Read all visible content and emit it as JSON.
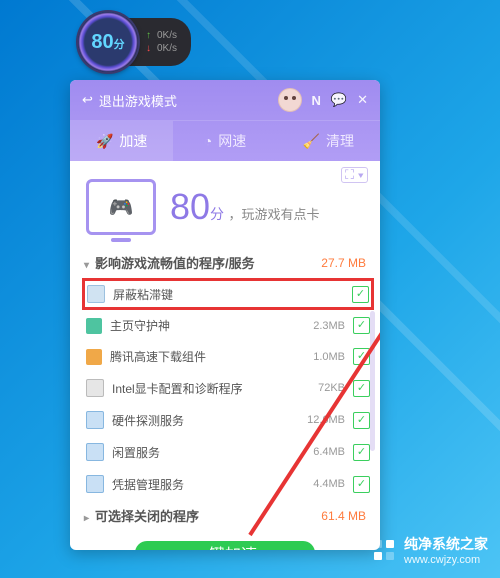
{
  "widget": {
    "score": "80",
    "unit": "分",
    "up": "0K/s",
    "down": "0K/s"
  },
  "header": {
    "back_label": "退出游戏模式",
    "tabs": [
      {
        "label": "加速",
        "icon": "rocket",
        "active": true
      },
      {
        "label": "网速",
        "icon": "gauge"
      },
      {
        "label": "清理",
        "icon": "broom"
      }
    ]
  },
  "score": {
    "value": "80",
    "unit": "分",
    "comment": "，玩游戏有点卡"
  },
  "sections": [
    {
      "title": "影响游戏流畅值的程序/服务",
      "size": "27.7 MB",
      "expanded": true,
      "items": [
        {
          "icon": "screen",
          "name": "屏蔽粘滞键",
          "size": "",
          "checked": true,
          "highlight": true
        },
        {
          "icon": "shield",
          "name": "主页守护神",
          "size": "2.3MB",
          "checked": true
        },
        {
          "icon": "box",
          "name": "腾讯高速下载组件",
          "size": "1.0MB",
          "checked": true
        },
        {
          "icon": "set",
          "name": "Intel显卡配置和诊断程序",
          "size": "72KB",
          "checked": true
        },
        {
          "icon": "doc",
          "name": "硬件探测服务",
          "size": "12.6MB",
          "checked": true
        },
        {
          "icon": "doc",
          "name": "闲置服务",
          "size": "6.4MB",
          "checked": true
        },
        {
          "icon": "doc",
          "name": "凭据管理服务",
          "size": "4.4MB",
          "checked": true
        }
      ]
    },
    {
      "title": "可选择关闭的程序",
      "size": "61.4 MB",
      "expanded": false,
      "items": []
    }
  ],
  "action": {
    "label": "一键加速"
  },
  "footer": {
    "brand": "纯净系统之家",
    "url": "www.cwjzy.com"
  }
}
